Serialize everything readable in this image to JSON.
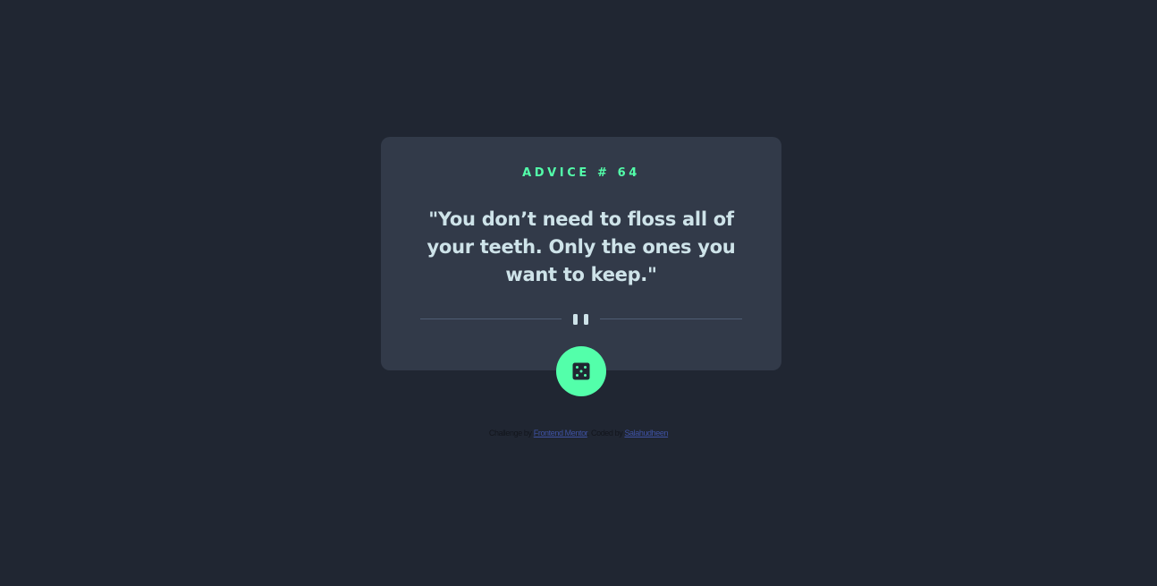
{
  "advice": {
    "heading": "ADVICE # 64",
    "quote": "\"You don’t need to floss all of your teeth. Only the ones you want to keep.\""
  },
  "divider": {
    "icon": "pause-icon"
  },
  "dice_button": {
    "icon": "dice-icon"
  },
  "attribution": {
    "prefix": "Challenge by",
    "challenge_link": "Frontend Mentor",
    "middle": ". Coded by",
    "author_link": "Salahudheen"
  },
  "colors": {
    "background": "#202632",
    "card": "#323a49",
    "accent": "#53ffaa",
    "quote_text": "#cee3e9",
    "divider": "#4f5d74"
  }
}
